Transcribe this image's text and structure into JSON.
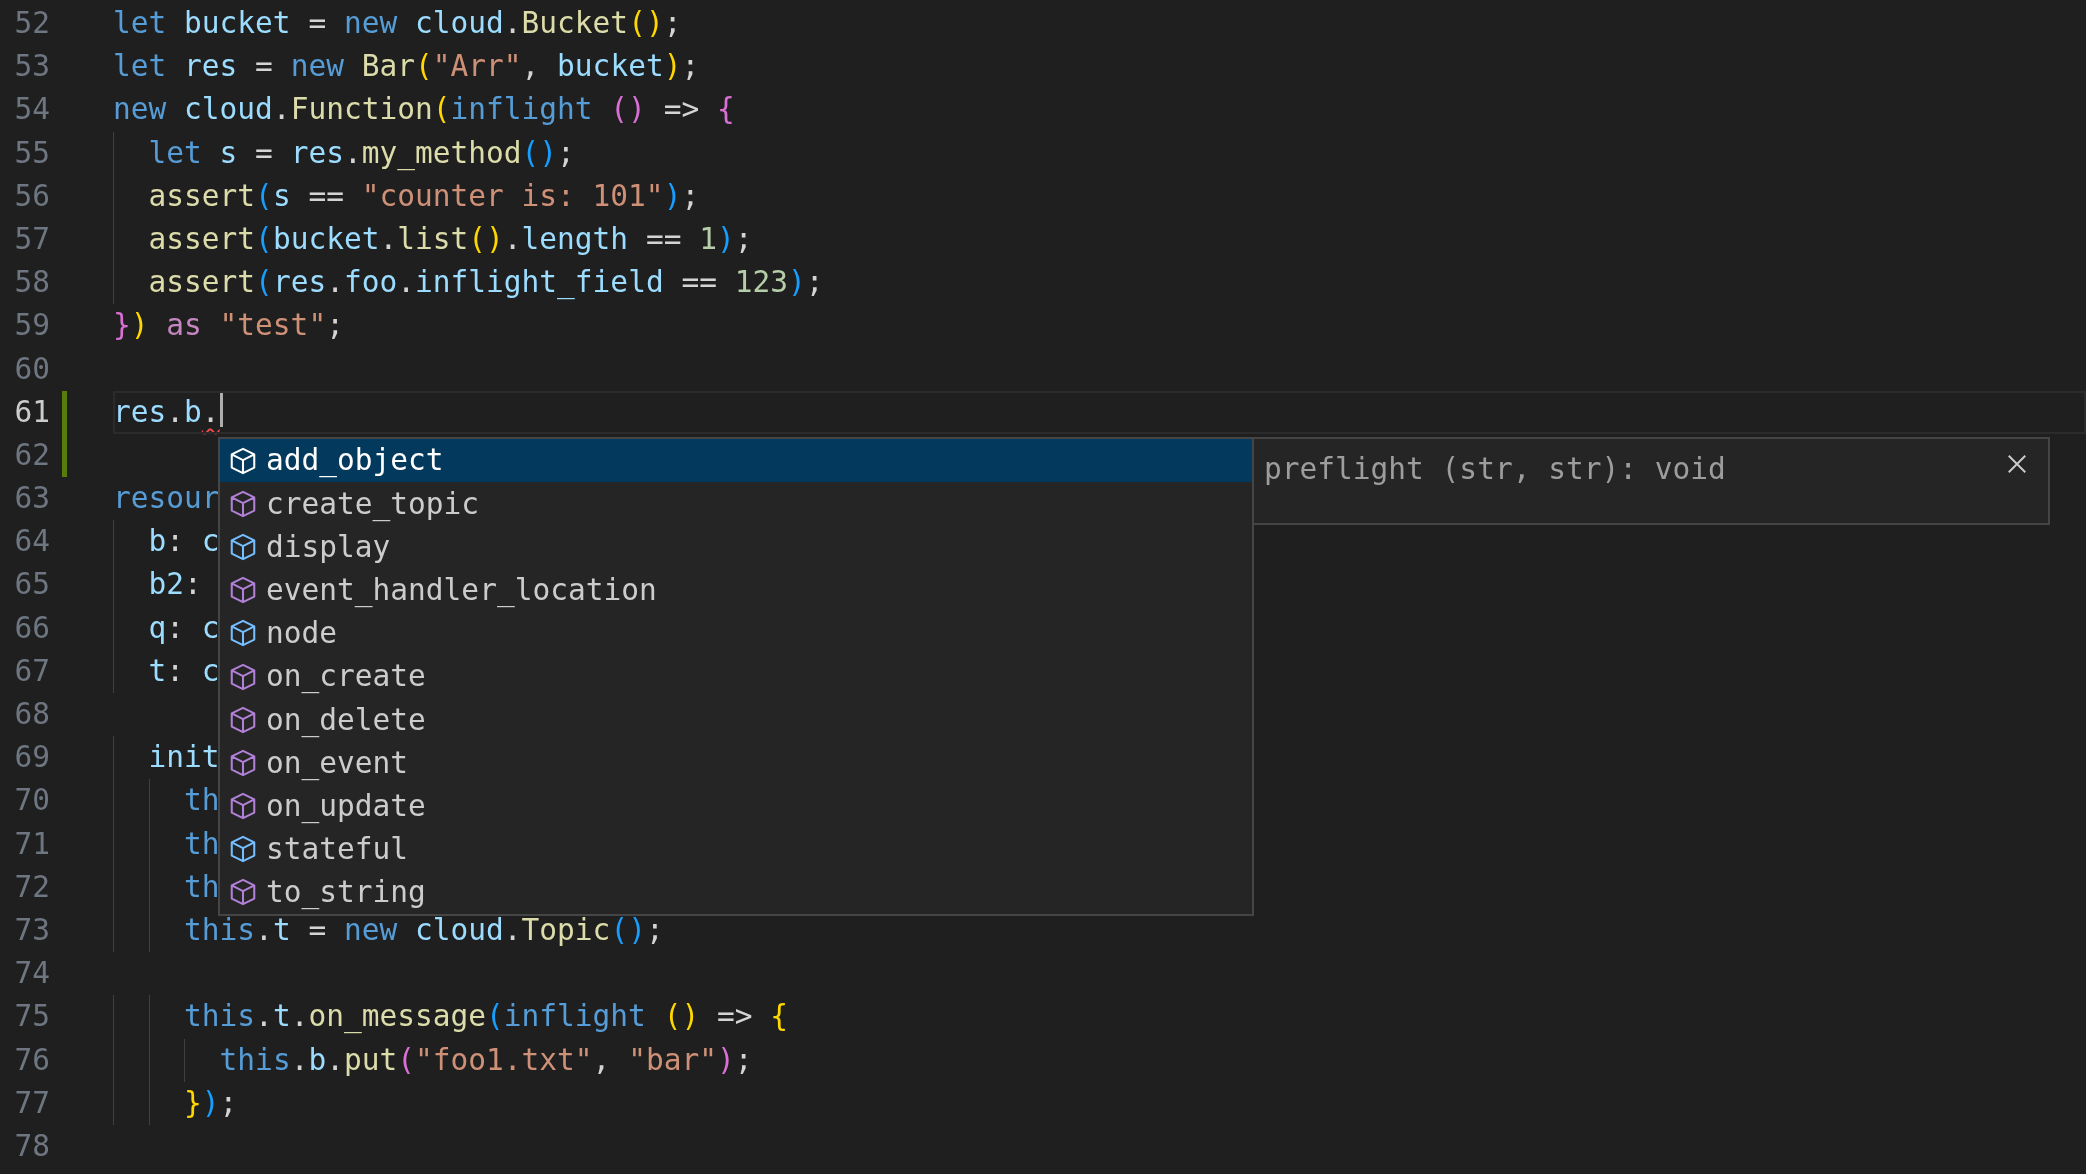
{
  "editor": {
    "lines": [
      {
        "number": "52",
        "current": false,
        "changed": false,
        "tokens": [
          {
            "text": "let ",
            "kind": "kw"
          },
          {
            "text": "bucket",
            "kind": "var"
          },
          {
            "text": " = ",
            "kind": "op"
          },
          {
            "text": "new ",
            "kind": "kw"
          },
          {
            "text": "cloud",
            "kind": "var"
          },
          {
            "text": ".",
            "kind": "op"
          },
          {
            "text": "Bucket",
            "kind": "fn"
          },
          {
            "text": "()",
            "kind": "b1"
          },
          {
            "text": ";",
            "kind": "op"
          }
        ]
      },
      {
        "number": "53",
        "current": false,
        "changed": false,
        "tokens": [
          {
            "text": "let ",
            "kind": "kw"
          },
          {
            "text": "res",
            "kind": "var"
          },
          {
            "text": " = ",
            "kind": "op"
          },
          {
            "text": "new ",
            "kind": "kw"
          },
          {
            "text": "Bar",
            "kind": "fn"
          },
          {
            "text": "(",
            "kind": "b1"
          },
          {
            "text": "\"Arr\"",
            "kind": "str"
          },
          {
            "text": ", ",
            "kind": "op"
          },
          {
            "text": "bucket",
            "kind": "var"
          },
          {
            "text": ")",
            "kind": "b1"
          },
          {
            "text": ";",
            "kind": "op"
          }
        ]
      },
      {
        "number": "54",
        "current": false,
        "changed": false,
        "tokens": [
          {
            "text": "new ",
            "kind": "kw"
          },
          {
            "text": "cloud",
            "kind": "var"
          },
          {
            "text": ".",
            "kind": "op"
          },
          {
            "text": "Function",
            "kind": "fn"
          },
          {
            "text": "(",
            "kind": "b1"
          },
          {
            "text": "inflight ",
            "kind": "kw"
          },
          {
            "text": "()",
            "kind": "b2"
          },
          {
            "text": " => ",
            "kind": "op"
          },
          {
            "text": "{",
            "kind": "b2"
          }
        ]
      },
      {
        "number": "55",
        "current": false,
        "changed": false,
        "tokens": [
          {
            "text": "  let ",
            "kind": "kw"
          },
          {
            "text": "s",
            "kind": "var"
          },
          {
            "text": " = ",
            "kind": "op"
          },
          {
            "text": "res",
            "kind": "var"
          },
          {
            "text": ".",
            "kind": "op"
          },
          {
            "text": "my_method",
            "kind": "fn"
          },
          {
            "text": "()",
            "kind": "b3"
          },
          {
            "text": ";",
            "kind": "op"
          }
        ]
      },
      {
        "number": "56",
        "current": false,
        "changed": false,
        "tokens": [
          {
            "text": "  assert",
            "kind": "fn"
          },
          {
            "text": "(",
            "kind": "b3"
          },
          {
            "text": "s",
            "kind": "var"
          },
          {
            "text": " == ",
            "kind": "op"
          },
          {
            "text": "\"counter is: 101\"",
            "kind": "str"
          },
          {
            "text": ")",
            "kind": "b3"
          },
          {
            "text": ";",
            "kind": "op"
          }
        ]
      },
      {
        "number": "57",
        "current": false,
        "changed": false,
        "tokens": [
          {
            "text": "  assert",
            "kind": "fn"
          },
          {
            "text": "(",
            "kind": "b3"
          },
          {
            "text": "bucket",
            "kind": "var"
          },
          {
            "text": ".",
            "kind": "op"
          },
          {
            "text": "list",
            "kind": "fn"
          },
          {
            "text": "()",
            "kind": "b1"
          },
          {
            "text": ".",
            "kind": "op"
          },
          {
            "text": "length",
            "kind": "var"
          },
          {
            "text": " == ",
            "kind": "op"
          },
          {
            "text": "1",
            "kind": "num"
          },
          {
            "text": ")",
            "kind": "b3"
          },
          {
            "text": ";",
            "kind": "op"
          }
        ]
      },
      {
        "number": "58",
        "current": false,
        "changed": false,
        "tokens": [
          {
            "text": "  assert",
            "kind": "fn"
          },
          {
            "text": "(",
            "kind": "b3"
          },
          {
            "text": "res",
            "kind": "var"
          },
          {
            "text": ".",
            "kind": "op"
          },
          {
            "text": "foo",
            "kind": "var"
          },
          {
            "text": ".",
            "kind": "op"
          },
          {
            "text": "inflight_field",
            "kind": "var"
          },
          {
            "text": " == ",
            "kind": "op"
          },
          {
            "text": "123",
            "kind": "num"
          },
          {
            "text": ")",
            "kind": "b3"
          },
          {
            "text": ";",
            "kind": "op"
          }
        ]
      },
      {
        "number": "59",
        "current": false,
        "changed": false,
        "tokens": [
          {
            "text": "}",
            "kind": "b2"
          },
          {
            "text": ")",
            "kind": "b1"
          },
          {
            "text": " as ",
            "kind": "ctl"
          },
          {
            "text": "\"test\"",
            "kind": "str"
          },
          {
            "text": ";",
            "kind": "op"
          }
        ]
      },
      {
        "number": "60",
        "current": false,
        "changed": false
      },
      {
        "number": "61",
        "current": true,
        "changed": true,
        "tokens": [
          {
            "text": "res",
            "kind": "var"
          },
          {
            "text": ".",
            "kind": "op"
          },
          {
            "text": "b",
            "kind": "var"
          },
          {
            "text": ".",
            "kind": "err"
          }
        ]
      },
      {
        "number": "62",
        "current": false,
        "changed": true
      },
      {
        "number": "63",
        "current": false,
        "changed": false,
        "tokens": [
          {
            "text": "resour",
            "kind": "kw"
          }
        ]
      },
      {
        "number": "64",
        "current": false,
        "changed": false,
        "tokens": [
          {
            "text": "  b",
            "kind": "var"
          },
          {
            "text": ": ",
            "kind": "op"
          },
          {
            "text": "c",
            "kind": "var"
          }
        ]
      },
      {
        "number": "65",
        "current": false,
        "changed": false,
        "tokens": [
          {
            "text": "  b2",
            "kind": "var"
          },
          {
            "text": ":",
            "kind": "op"
          }
        ]
      },
      {
        "number": "66",
        "current": false,
        "changed": false,
        "tokens": [
          {
            "text": "  q",
            "kind": "var"
          },
          {
            "text": ": ",
            "kind": "op"
          },
          {
            "text": "c",
            "kind": "var"
          }
        ]
      },
      {
        "number": "67",
        "current": false,
        "changed": false,
        "tokens": [
          {
            "text": "  t",
            "kind": "var"
          },
          {
            "text": ": ",
            "kind": "op"
          },
          {
            "text": "c",
            "kind": "var"
          }
        ]
      },
      {
        "number": "68",
        "current": false,
        "changed": false
      },
      {
        "number": "69",
        "current": false,
        "changed": false,
        "tokens": [
          {
            "text": "  init",
            "kind": "var"
          }
        ]
      },
      {
        "number": "70",
        "current": false,
        "changed": false,
        "tokens": [
          {
            "text": "    th",
            "kind": "kw"
          }
        ]
      },
      {
        "number": "71",
        "current": false,
        "changed": false,
        "tokens": [
          {
            "text": "    th",
            "kind": "kw"
          }
        ]
      },
      {
        "number": "72",
        "current": false,
        "changed": false,
        "tokens": [
          {
            "text": "    th",
            "kind": "kw"
          }
        ]
      },
      {
        "number": "73",
        "current": false,
        "changed": false,
        "tokens": [
          {
            "text": "    this",
            "kind": "kw"
          },
          {
            "text": ".",
            "kind": "op"
          },
          {
            "text": "t",
            "kind": "var"
          },
          {
            "text": " = ",
            "kind": "op"
          },
          {
            "text": "new ",
            "kind": "kw"
          },
          {
            "text": "cloud",
            "kind": "var"
          },
          {
            "text": ".",
            "kind": "op"
          },
          {
            "text": "Topic",
            "kind": "fn"
          },
          {
            "text": "()",
            "kind": "b3"
          },
          {
            "text": ";",
            "kind": "op"
          }
        ]
      },
      {
        "number": "74",
        "current": false,
        "changed": false
      },
      {
        "number": "75",
        "current": false,
        "changed": false,
        "tokens": [
          {
            "text": "    this",
            "kind": "kw"
          },
          {
            "text": ".",
            "kind": "op"
          },
          {
            "text": "t",
            "kind": "var"
          },
          {
            "text": ".",
            "kind": "op"
          },
          {
            "text": "on_message",
            "kind": "fn"
          },
          {
            "text": "(",
            "kind": "b3"
          },
          {
            "text": "inflight ",
            "kind": "kw"
          },
          {
            "text": "()",
            "kind": "b1"
          },
          {
            "text": " => ",
            "kind": "op"
          },
          {
            "text": "{",
            "kind": "b1"
          }
        ]
      },
      {
        "number": "76",
        "current": false,
        "changed": false,
        "tokens": [
          {
            "text": "      this",
            "kind": "kw"
          },
          {
            "text": ".",
            "kind": "op"
          },
          {
            "text": "b",
            "kind": "var"
          },
          {
            "text": ".",
            "kind": "op"
          },
          {
            "text": "put",
            "kind": "fn"
          },
          {
            "text": "(",
            "kind": "b2"
          },
          {
            "text": "\"foo1.txt\"",
            "kind": "str"
          },
          {
            "text": ", ",
            "kind": "op"
          },
          {
            "text": "\"bar\"",
            "kind": "str"
          },
          {
            "text": ")",
            "kind": "b2"
          },
          {
            "text": ";",
            "kind": "op"
          }
        ]
      },
      {
        "number": "77",
        "current": false,
        "changed": false,
        "tokens": [
          {
            "text": "    }",
            "kind": "b1"
          },
          {
            "text": ")",
            "kind": "b3"
          },
          {
            "text": ";",
            "kind": "op"
          }
        ]
      },
      {
        "number": "78",
        "current": false,
        "changed": false
      }
    ]
  },
  "suggest": {
    "items": [
      {
        "label": "add_object",
        "kind": "method",
        "selected": true
      },
      {
        "label": "create_topic",
        "kind": "method",
        "selected": false
      },
      {
        "label": "display",
        "kind": "field",
        "selected": false
      },
      {
        "label": "event_handler_location",
        "kind": "method",
        "selected": false
      },
      {
        "label": "node",
        "kind": "field",
        "selected": false
      },
      {
        "label": "on_create",
        "kind": "method",
        "selected": false
      },
      {
        "label": "on_delete",
        "kind": "method",
        "selected": false
      },
      {
        "label": "on_event",
        "kind": "method",
        "selected": false
      },
      {
        "label": "on_update",
        "kind": "method",
        "selected": false
      },
      {
        "label": "stateful",
        "kind": "field",
        "selected": false
      },
      {
        "label": "to_string",
        "kind": "method",
        "selected": false
      }
    ],
    "detail": {
      "text": "preflight (str, str): void"
    }
  }
}
